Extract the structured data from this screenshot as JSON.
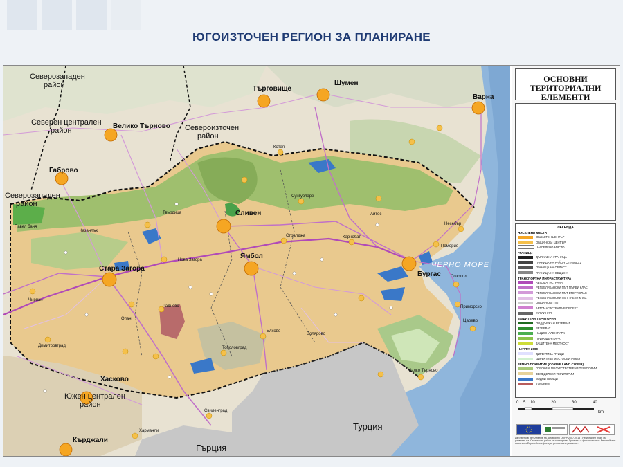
{
  "title": "ЮГОИЗТОЧЕН РЕГИОН ЗА ПЛАНИРАНЕ",
  "map": {
    "region_labels": [
      {
        "id": "nw1",
        "text": "Северозападен"
      },
      {
        "id": "nw2",
        "text": "район"
      },
      {
        "id": "nc1",
        "text": "Северен централен"
      },
      {
        "id": "nc2",
        "text": "район"
      },
      {
        "id": "ne1",
        "text": "Североизточен"
      },
      {
        "id": "ne2",
        "text": "район"
      },
      {
        "id": "sw1",
        "text": "Северозападен"
      },
      {
        "id": "sw2",
        "text": "район"
      },
      {
        "id": "sc1",
        "text": "Южен централен"
      },
      {
        "id": "sc2",
        "text": "район"
      }
    ],
    "cities": {
      "varna": "Варна",
      "shumen": "Шумен",
      "targovishte": "Търговище",
      "veliko": "Велико Търново",
      "gabrovo": "Габрово",
      "sliven": "Сливен",
      "yambol": "Ямбол",
      "burgas": "Бургас",
      "stara_zagora": "Стара Загора",
      "haskovo": "Хасково",
      "kardzhali": "Кърджали",
      "nesebar": "Несебър",
      "pomorie": "Поморие",
      "sozopol": "Созопол",
      "primorsko": "Приморско",
      "tsarevo": "Царево",
      "malko": "Малко Търново",
      "elhovo": "Елхово",
      "kazanlak": "Казанлък",
      "nova_zagora": "Нова Загора",
      "radnevo": "Раднево",
      "chirpan": "Чирпан",
      "dimitrovgrad": "Димитровград",
      "svilengrad": "Свиленград",
      "karnobat": "Карнобат",
      "aytos": "Айтос",
      "sungurlare": "Сунгурларе",
      "kotel": "Котел",
      "tvarditsa": "Твърдица",
      "straldzha": "Стралджа",
      "bolyarovo": "Болярово",
      "topolovgrad": "Тополовград",
      "kharmanli": "Харманли",
      "pavel": "Павел баня",
      "opan": "Опан"
    },
    "sea_label": "ЧЕРНО МОРЕ",
    "countries": {
      "turkey": "Турция",
      "greece": "Гърция"
    }
  },
  "legend": {
    "title_lines": [
      "ОСНОВНИ",
      "ТЕРИТОРИАЛНИ",
      "ЕЛЕМЕНТИ"
    ],
    "heading": "ЛЕГЕНДА",
    "sections": [
      {
        "name": "НАСЕЛЕНИ МЕСТА",
        "items": [
          {
            "label": "ОБЛАСТЕН ЦЕНТЪР",
            "color": "#f5a623"
          },
          {
            "label": "ОБЩИНСКИ ЦЕНТЪР",
            "color": "#f5c04a"
          },
          {
            "label": "НАСЕЛЕНО МЯСТО",
            "color": "#ffffff"
          }
        ]
      },
      {
        "name": "ГРАНИЦИ",
        "items": [
          {
            "label": "ДЪРЖАВНА ГРАНИЦА",
            "color": "#222222"
          },
          {
            "label": "ГРАНИЦА НА РАЙОН ОТ НИВО 2",
            "color": "#444444"
          },
          {
            "label": "ГРАНИЦА НА ОБЛАСТ",
            "color": "#555555"
          },
          {
            "label": "ГРАНИЦА НА ОБЩИНА",
            "color": "#888888"
          }
        ]
      },
      {
        "name": "ТРАНСПОРТНА ИНФРАСТРУКТУРА",
        "items": [
          {
            "label": "АВТОМАГИСТРАЛА",
            "color": "#b04ab8"
          },
          {
            "label": "РЕПУБЛИКАНСКИ ПЪТ ПЪРВИ КЛАС",
            "color": "#c070c8"
          },
          {
            "label": "РЕПУБЛИКАНСКИ ПЪТ ВТОРИ КЛАС",
            "color": "#d39ad8"
          },
          {
            "label": "РЕПУБЛИКАНСКИ ПЪТ ТРЕТИ КЛАС",
            "color": "#e2c0e5"
          },
          {
            "label": "ОБЩИНСКИ ПЪТ",
            "color": "#cccccc"
          },
          {
            "label": "АВТОМАГИСТРАЛА В ПРОЕКТ",
            "color": "#d080d0"
          },
          {
            "label": "ЖП ЛИНИЯ",
            "color": "#666666"
          }
        ]
      },
      {
        "name": "ЗАЩИТЕНИ ТЕРИТОРИИ",
        "items": [
          {
            "label": "ПОДДЪРЖАН РЕЗЕРВАТ",
            "color": "#1f6b1f"
          },
          {
            "label": "РЕЗЕРВАТ",
            "color": "#2f8f2f"
          },
          {
            "label": "НАЦИОНАЛЕН ПАРК",
            "color": "#4caf50"
          },
          {
            "label": "ПРИРОДЕН ПАРК",
            "color": "#8bc34a"
          },
          {
            "label": "ЗАЩИТЕНА МЕСТНОСТ",
            "color": "#cddc39"
          }
        ]
      },
      {
        "name": "НАТУРА 2000",
        "items": [
          {
            "label": "ДИРЕКТИВА ПТИЦИ",
            "color": "#e0e0ff"
          },
          {
            "label": "ДИРЕКТИВА МЕСТООБИТАНИЯ",
            "color": "#d0f0d0"
          }
        ]
      },
      {
        "name": "ЗЕМНО ПОКРИТИЕ (CORINE LAND COVER)",
        "items": [
          {
            "label": "ГОРСКИ И ПОЛУЕСТЕСТВЕНИ ТЕРИТОРИИ",
            "color": "#a8c97a"
          },
          {
            "label": "ЗЕМЕДЕЛСКИ ТЕРИТОРИИ",
            "color": "#e7d39a"
          },
          {
            "label": "ВОДНИ ПЛОЩИ",
            "color": "#3a78c8"
          },
          {
            "label": "КАРИЕРИ",
            "color": "#b85c5c"
          }
        ]
      }
    ],
    "scale_ticks": [
      "0",
      "5",
      "10",
      "20",
      "30",
      "40"
    ],
    "scale_unit": "km",
    "fine_print": "Изготвено в изпълнение на договор по ОПРР 2007-2013 - Регионален план за развитие на Югоизточен район за планиране. Проектът е финансиран от Европейския съюз чрез Европейския фонд за регионално развитие."
  }
}
